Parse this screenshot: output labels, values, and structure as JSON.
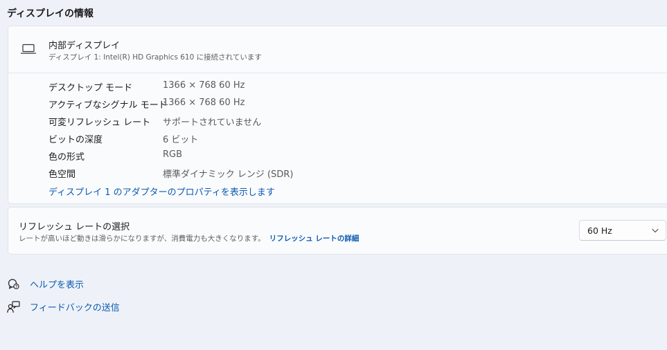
{
  "section_title": "ディスプレイの情報",
  "display": {
    "icon": "laptop-icon",
    "name": "内部ディスプレイ",
    "subtitle": "ディスプレイ 1: Intel(R) HD Graphics 610 に接続されています",
    "properties": [
      {
        "label": "デスクトップ モード",
        "value": "1366 × 768 60 Hz"
      },
      {
        "label": "アクティブなシグナル モード",
        "value": "1366 × 768 60 Hz"
      },
      {
        "label": "可変リフレッシュ レート",
        "value": "サポートされていません"
      },
      {
        "label": "ビットの深度",
        "value": "6 ビット"
      },
      {
        "label": "色の形式",
        "value": "RGB"
      },
      {
        "label": "色空間",
        "value": "標準ダイナミック レンジ (SDR)"
      }
    ],
    "adapter_link": "ディスプレイ 1 のアダプターのプロパティを表示します"
  },
  "refresh": {
    "title": "リフレッシュ レートの選択",
    "description": "レートが高いほど動きは滑らかになりますが、消費電力も大きくなります。",
    "detail_link": "リフレッシュ レートの詳細",
    "selected": "60 Hz"
  },
  "help_links": {
    "help": {
      "icon": "help-icon",
      "label": "ヘルプを表示"
    },
    "feedback": {
      "icon": "feedback-icon",
      "label": "フィードバックの送信"
    }
  },
  "colors": {
    "background": "#eef2f8",
    "card": "#fafbfd",
    "link": "#0a5ab1"
  }
}
